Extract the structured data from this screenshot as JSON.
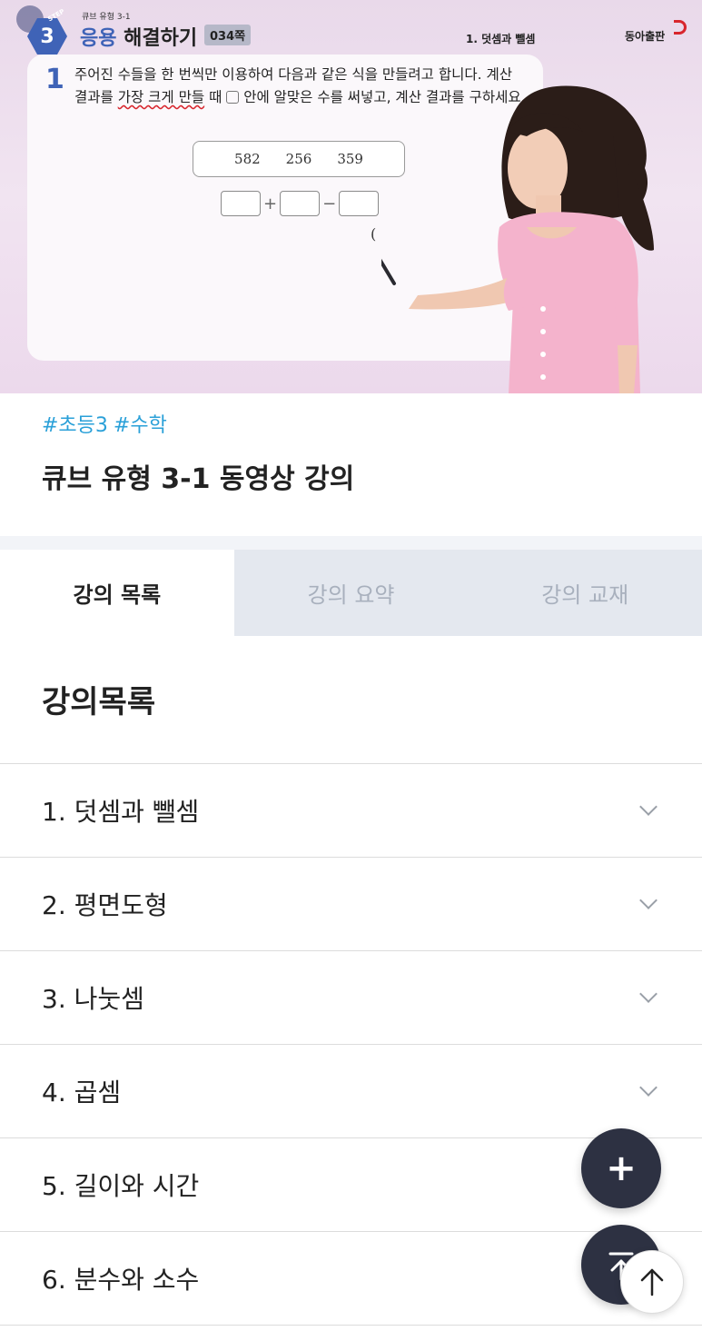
{
  "video": {
    "book_subtitle": "큐브 유형 3-1",
    "step_small": "STEP",
    "step_number": "3",
    "section_title_blue": "응용",
    "section_title_dark": "해결하기",
    "page_tag": "034쪽",
    "chapter_label": "1. 덧셈과 뺄셈",
    "publisher": "동아출판",
    "problem": {
      "number": "1",
      "text_part1": "주어진 수들을 한 번씩만 이용하여 다음과 같은 식을 만들려고 합니다. 계산 결과를 ",
      "text_emphasis": "가장 크게 만들",
      "text_part2": " 때 ",
      "text_part3": " 안에 알맞은 수를 써넣고, 계산 결과를 구하세요.",
      "numbers": [
        "582",
        "256",
        "359"
      ],
      "op_plus": "+",
      "op_minus": "−",
      "paren": "("
    }
  },
  "hashtags": [
    "#초등3",
    "#수학"
  ],
  "page_title": "큐브 유형 3-1 동영상 강의",
  "tabs": [
    {
      "label": "강의 목록",
      "active": true
    },
    {
      "label": "강의 요약",
      "active": false
    },
    {
      "label": "강의 교재",
      "active": false
    }
  ],
  "list_heading": "강의목록",
  "chapters": [
    {
      "label": "1. 덧셈과 뺄셈",
      "icon": "chevron-down-icon"
    },
    {
      "label": "2. 평면도형",
      "icon": "chevron-down-icon"
    },
    {
      "label": "3. 나눗셈",
      "icon": "chevron-down-icon"
    },
    {
      "label": "4. 곱셈",
      "icon": "chevron-down-icon"
    },
    {
      "label": "5. 길이와 시간",
      "icon": "chevron-down-icon"
    },
    {
      "label": "6. 분수와 소수",
      "icon": "chevron-down-icon"
    }
  ],
  "fab": {
    "plus_label": "+",
    "plus_icon": "plus-icon",
    "top_icon": "scroll-top-icon",
    "arrow_icon": "arrow-up-icon"
  },
  "colors": {
    "accent_blue": "#3f63b7",
    "hashtag": "#2aa0d8",
    "fab": "#2d3142",
    "tab_inactive_bg": "#e4e8ef"
  }
}
